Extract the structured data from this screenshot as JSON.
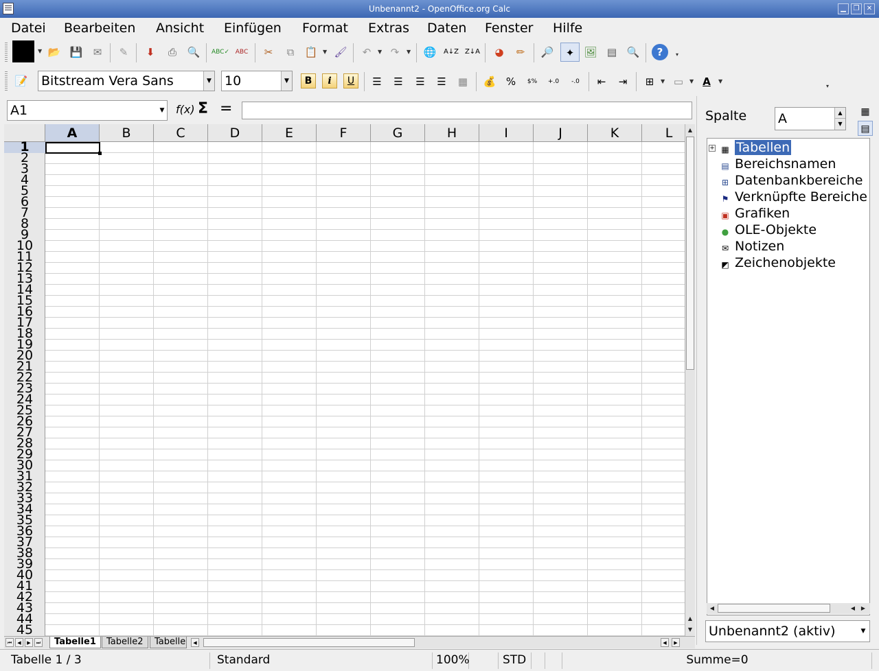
{
  "window": {
    "title": "Unbenannt2 - OpenOffice.org Calc",
    "minimize_icon": "minimize-icon",
    "maximize_icon": "restore-icon",
    "close_icon": "close-icon"
  },
  "menu": [
    {
      "label": "Datei"
    },
    {
      "label": "Bearbeiten"
    },
    {
      "label": "Ansicht"
    },
    {
      "label": "Einfügen"
    },
    {
      "label": "Format"
    },
    {
      "label": "Extras"
    },
    {
      "label": "Daten"
    },
    {
      "label": "Fenster"
    },
    {
      "label": "Hilfe"
    }
  ],
  "formatting": {
    "font_name": "Bitstream Vera Sans",
    "font_size": "10",
    "bold_label": "B",
    "italic_label": "i",
    "underline_label": "U",
    "percent_label": "%"
  },
  "formula_bar": {
    "name_box": "A1",
    "fx_label": "f(x)",
    "sum_label": "Σ",
    "equals_label": "=",
    "formula": ""
  },
  "sheet": {
    "columns": [
      "A",
      "B",
      "C",
      "D",
      "E",
      "F",
      "G",
      "H",
      "I",
      "J",
      "K",
      "L"
    ],
    "active_column": "A",
    "active_row": 1,
    "row_count": 45,
    "tabs": [
      "Tabelle1",
      "Tabelle2",
      "Tabelle"
    ],
    "active_tab": "Tabelle1"
  },
  "navigator": {
    "column_label": "Spalte",
    "column_value": "A",
    "items": [
      {
        "label": "Tabellen",
        "icon": "table-icon",
        "selected": true
      },
      {
        "label": "Bereichsnamen",
        "icon": "range-names-icon"
      },
      {
        "label": "Datenbankbereiche",
        "icon": "database-range-icon"
      },
      {
        "label": "Verknüpfte Bereiche",
        "icon": "linked-range-icon"
      },
      {
        "label": "Grafiken",
        "icon": "graphics-icon"
      },
      {
        "label": "OLE-Objekte",
        "icon": "ole-object-icon"
      },
      {
        "label": "Notizen",
        "icon": "notes-icon"
      },
      {
        "label": "Zeichenobjekte",
        "icon": "drawing-object-icon"
      }
    ],
    "document": "Unbenannt2 (aktiv)"
  },
  "status": {
    "sheet_info": "Tabelle 1 / 3",
    "page_style": "Standard",
    "zoom": "100%",
    "mode": "STD",
    "sum": "Summe=0"
  },
  "colors": {
    "titlebar": "#4a74c0",
    "selection": "#3d6ab6",
    "header_active": "#c9d3e6"
  }
}
